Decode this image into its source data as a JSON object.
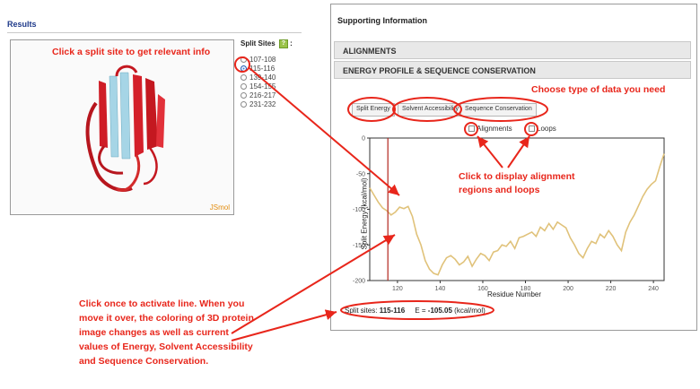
{
  "results": {
    "title": "Results"
  },
  "viewer": {
    "brand": "JSmol"
  },
  "split_sites": {
    "title": "Split Sites",
    "help_icon": "?",
    "colon": ":",
    "items": [
      {
        "label": "107-108",
        "selected": false
      },
      {
        "label": "115-116",
        "selected": true
      },
      {
        "label": "139-140",
        "selected": false
      },
      {
        "label": "154-155",
        "selected": false
      },
      {
        "label": "216-217",
        "selected": false
      },
      {
        "label": "231-232",
        "selected": false
      }
    ]
  },
  "supporting": {
    "title": "Supporting Information",
    "sections": [
      "ALIGNMENTS",
      "ENERGY PROFILE & SEQUENCE CONSERVATION"
    ],
    "data_buttons": [
      "Split Energy",
      "Solvent Accessibility",
      "Sequence Conservation"
    ],
    "checkboxes": [
      "Alignments",
      "Loops"
    ],
    "readout": {
      "label": "Split sites:",
      "sites": "115-116",
      "energy_label": "E =",
      "energy_value": "-105.05",
      "unit": "(kcal/mol)"
    }
  },
  "annotations": {
    "click_split": "Click a split site to get relevant info",
    "choose_type": "Choose type of data you need",
    "display_regions": "Click to display alignment regions and loops",
    "activate_line": "Click once to activate line. When you move it over, the coloring of 3D protein image changes as well as current values of Energy, Solvent Accessibility and Sequence Conservation."
  },
  "colors": {
    "accent_red": "#e8261b",
    "line": "#e0c27a",
    "marker": "#b3261e"
  },
  "chart_data": {
    "type": "line",
    "title": "",
    "xlabel": "Residue Number",
    "ylabel": "Split Energy (kcal/mol)",
    "xlim": [
      107,
      245
    ],
    "ylim": [
      -200,
      0
    ],
    "xticks": [
      120,
      140,
      160,
      180,
      200,
      220,
      240
    ],
    "yticks": [
      0,
      -50,
      -100,
      -150,
      -200
    ],
    "marker_x": 115.5,
    "series": [
      {
        "x": [
          107,
          109,
          111,
          113,
          115,
          117,
          119,
          121,
          123,
          125,
          127,
          129,
          131,
          133,
          135,
          137,
          139,
          141,
          143,
          145,
          147,
          149,
          151,
          153,
          155,
          157,
          159,
          161,
          163,
          165,
          167,
          169,
          171,
          173,
          175,
          177,
          179,
          181,
          183,
          185,
          187,
          189,
          191,
          193,
          195,
          197,
          199,
          201,
          203,
          205,
          207,
          209,
          211,
          213,
          215,
          217,
          219,
          221,
          223,
          225,
          227,
          229,
          231,
          233,
          235,
          237,
          239,
          241,
          243,
          245
        ],
        "y": [
          -70,
          -80,
          -90,
          -98,
          -102,
          -108,
          -104,
          -97,
          -99,
          -96,
          -110,
          -135,
          -150,
          -172,
          -184,
          -190,
          -192,
          -178,
          -168,
          -165,
          -170,
          -178,
          -174,
          -166,
          -180,
          -170,
          -162,
          -165,
          -172,
          -160,
          -158,
          -150,
          -152,
          -145,
          -155,
          -140,
          -138,
          -135,
          -132,
          -138,
          -125,
          -130,
          -120,
          -128,
          -118,
          -122,
          -126,
          -140,
          -150,
          -162,
          -168,
          -155,
          -145,
          -148,
          -135,
          -140,
          -130,
          -138,
          -150,
          -158,
          -132,
          -118,
          -108,
          -95,
          -82,
          -72,
          -65,
          -60,
          -40,
          -22
        ]
      }
    ]
  }
}
